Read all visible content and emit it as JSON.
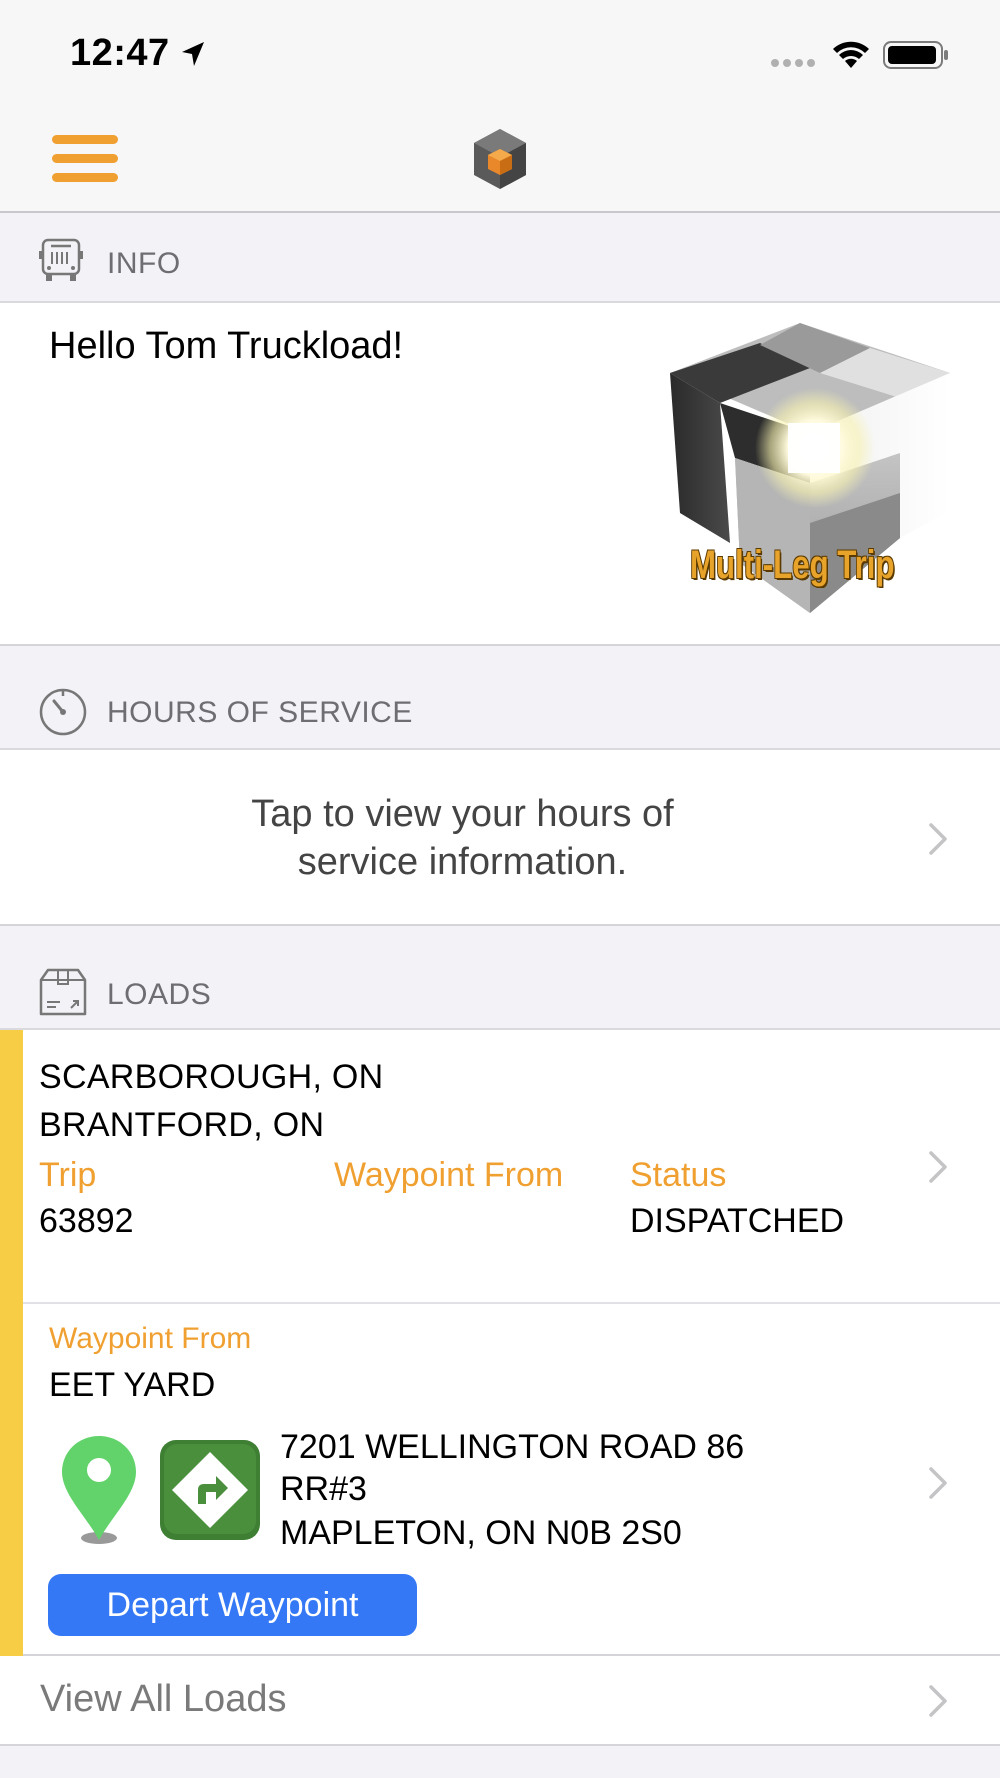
{
  "status_bar": {
    "time": "12:47"
  },
  "nav": {
    "menu_icon": "hamburger-icon",
    "logo_icon": "app-cube-logo"
  },
  "info": {
    "header": "INFO",
    "icon": "bus-icon",
    "greeting": "Hello Tom Truckload!",
    "badge_text": "Multi-Leg Trip"
  },
  "hours_of_service": {
    "header": "HOURS OF SERVICE",
    "icon": "gauge-icon",
    "message_line1": "Tap to view your hours of",
    "message_line2": "service information."
  },
  "loads": {
    "header": "LOADS",
    "icon": "box-icon",
    "origin": "SCARBOROUGH, ON",
    "destination": "BRANTFORD, ON",
    "trip_label": "Trip",
    "trip_value": "63892",
    "waypoint_from_label": "Waypoint From",
    "status_label": "Status",
    "status_value": "DISPATCHED"
  },
  "waypoint": {
    "label": "Waypoint From",
    "name": "EET YARD",
    "address_line1": "7201 WELLINGTON ROAD 86",
    "address_line2": "RR#3",
    "address_line3": "MAPLETON, ON N0B 2S0",
    "depart_button": "Depart Waypoint"
  },
  "view_all_loads": "View All Loads",
  "colors": {
    "accent_orange": "#f0a030",
    "load_bar_yellow": "#f8cd46",
    "button_blue": "#3478f6",
    "pin_green": "#62d36b",
    "directions_green": "#4a8f3c"
  }
}
